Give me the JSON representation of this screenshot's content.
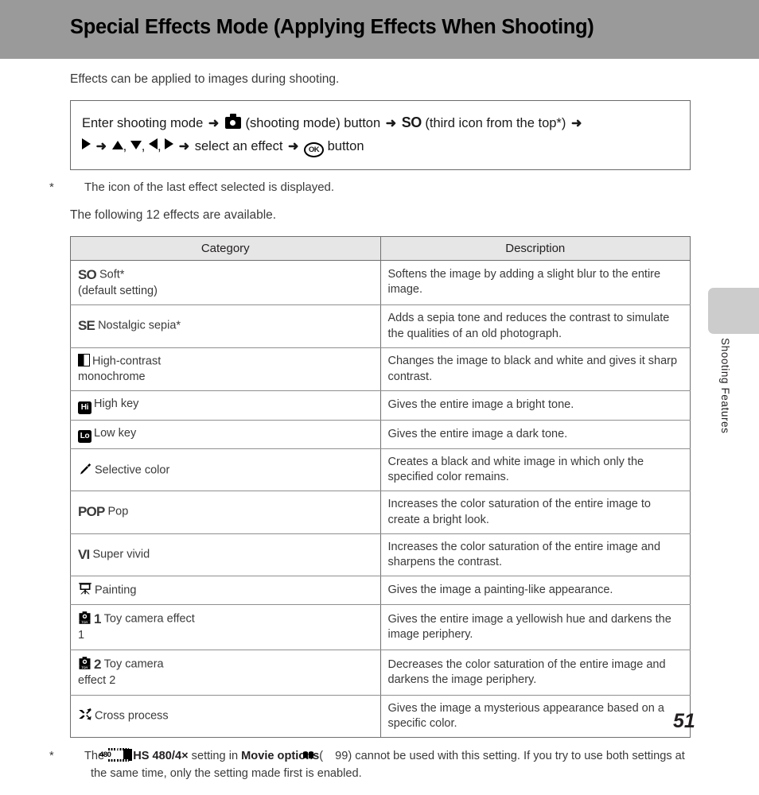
{
  "header": {
    "title": "Special Effects Mode (Applying Effects When Shooting)",
    "bar_color": "#9a9a9a"
  },
  "side_tab": {
    "label": "Shooting Features",
    "color": "#cccccc"
  },
  "intro": "Effects can be applied to images during shooting.",
  "procedure": {
    "line1_part1": "Enter shooting mode",
    "camera_icon_name": "camera-shooting-mode-icon",
    "line1_part2": "(shooting mode) button",
    "so_glyph": "SO",
    "line1_part3": "(third icon from the top*)",
    "line2_part1": "select an effect",
    "ok_glyph": "OK",
    "line2_part2": "button",
    "arrow": "➜",
    "comma": ",",
    "multi_glyph": ""
  },
  "note": {
    "star": "*",
    "text": "The icon of the last effect selected is displayed."
  },
  "following": "The following 12 effects are available.",
  "table": {
    "headers": [
      "Category",
      "Description"
    ],
    "rows": [
      {
        "icon": "so-glyph",
        "glyph_text": "SO",
        "label": "Soft*",
        "label2": "(default setting)",
        "description": "Softens the image by adding a slight blur to the entire image."
      },
      {
        "icon": "se-glyph",
        "glyph_text": "SE",
        "label": "Nostalgic sepia*",
        "label2": "",
        "description": "Adds a sepia tone and reduces the contrast to simulate the qualities of an old photograph."
      },
      {
        "icon": "high-contrast-monochrome-icon",
        "glyph_text": "",
        "label": "High-contrast",
        "label2": "monochrome",
        "description": "Changes the image to black and white and gives it sharp contrast."
      },
      {
        "icon": "high-key-icon",
        "glyph_text": "Hi",
        "label": "High key",
        "label2": "",
        "description": "Gives the entire image a bright tone."
      },
      {
        "icon": "low-key-icon",
        "glyph_text": "Lo",
        "label": "Low key",
        "label2": "",
        "description": "Gives the entire image a dark tone."
      },
      {
        "icon": "selective-color-eyedropper-icon",
        "glyph_text": "",
        "label": "Selective color",
        "label2": "",
        "description": "Creates a black and white image in which only the specified color remains."
      },
      {
        "icon": "pop-glyph",
        "glyph_text": "POP",
        "label": "Pop",
        "label2": "",
        "description": "Increases the color saturation of the entire image to create a bright look."
      },
      {
        "icon": "super-vivid-glyph",
        "glyph_text": "VI",
        "label": "Super vivid",
        "label2": "",
        "description": "Increases the color saturation of the entire image and sharpens the contrast."
      },
      {
        "icon": "painting-easel-icon",
        "glyph_text": "",
        "label": "Painting",
        "label2": "",
        "description": "Gives the image a painting-like appearance."
      },
      {
        "icon": "toy-camera-1-icon",
        "glyph_text": "1",
        "label": "Toy camera effect",
        "label2": "1",
        "description": "Gives the entire image a yellowish hue and darkens the image periphery."
      },
      {
        "icon": "toy-camera-2-icon",
        "glyph_text": "2",
        "label": "Toy camera",
        "label2": "effect 2",
        "description": "Decreases the color saturation of the entire image and darkens the image periphery."
      },
      {
        "icon": "cross-process-icon",
        "glyph_text": "",
        "label": "Cross process",
        "label2": "",
        "description": "Gives the image a mysterious appearance based on a specific color."
      }
    ]
  },
  "footnote": {
    "star": "*",
    "part1": "The",
    "icon_name": "hs-480-movie-icon",
    "icon_number": "480",
    "hs_setting": "HS 480/4×",
    "part2": "setting in",
    "movie_options": "Movie options",
    "paren_open": "(",
    "page_ref": "99",
    "paren_close": ")",
    "part3": "cannot be used with this setting. If you try to use both settings at the same time, only the setting made first is enabled."
  },
  "page_number": "51"
}
